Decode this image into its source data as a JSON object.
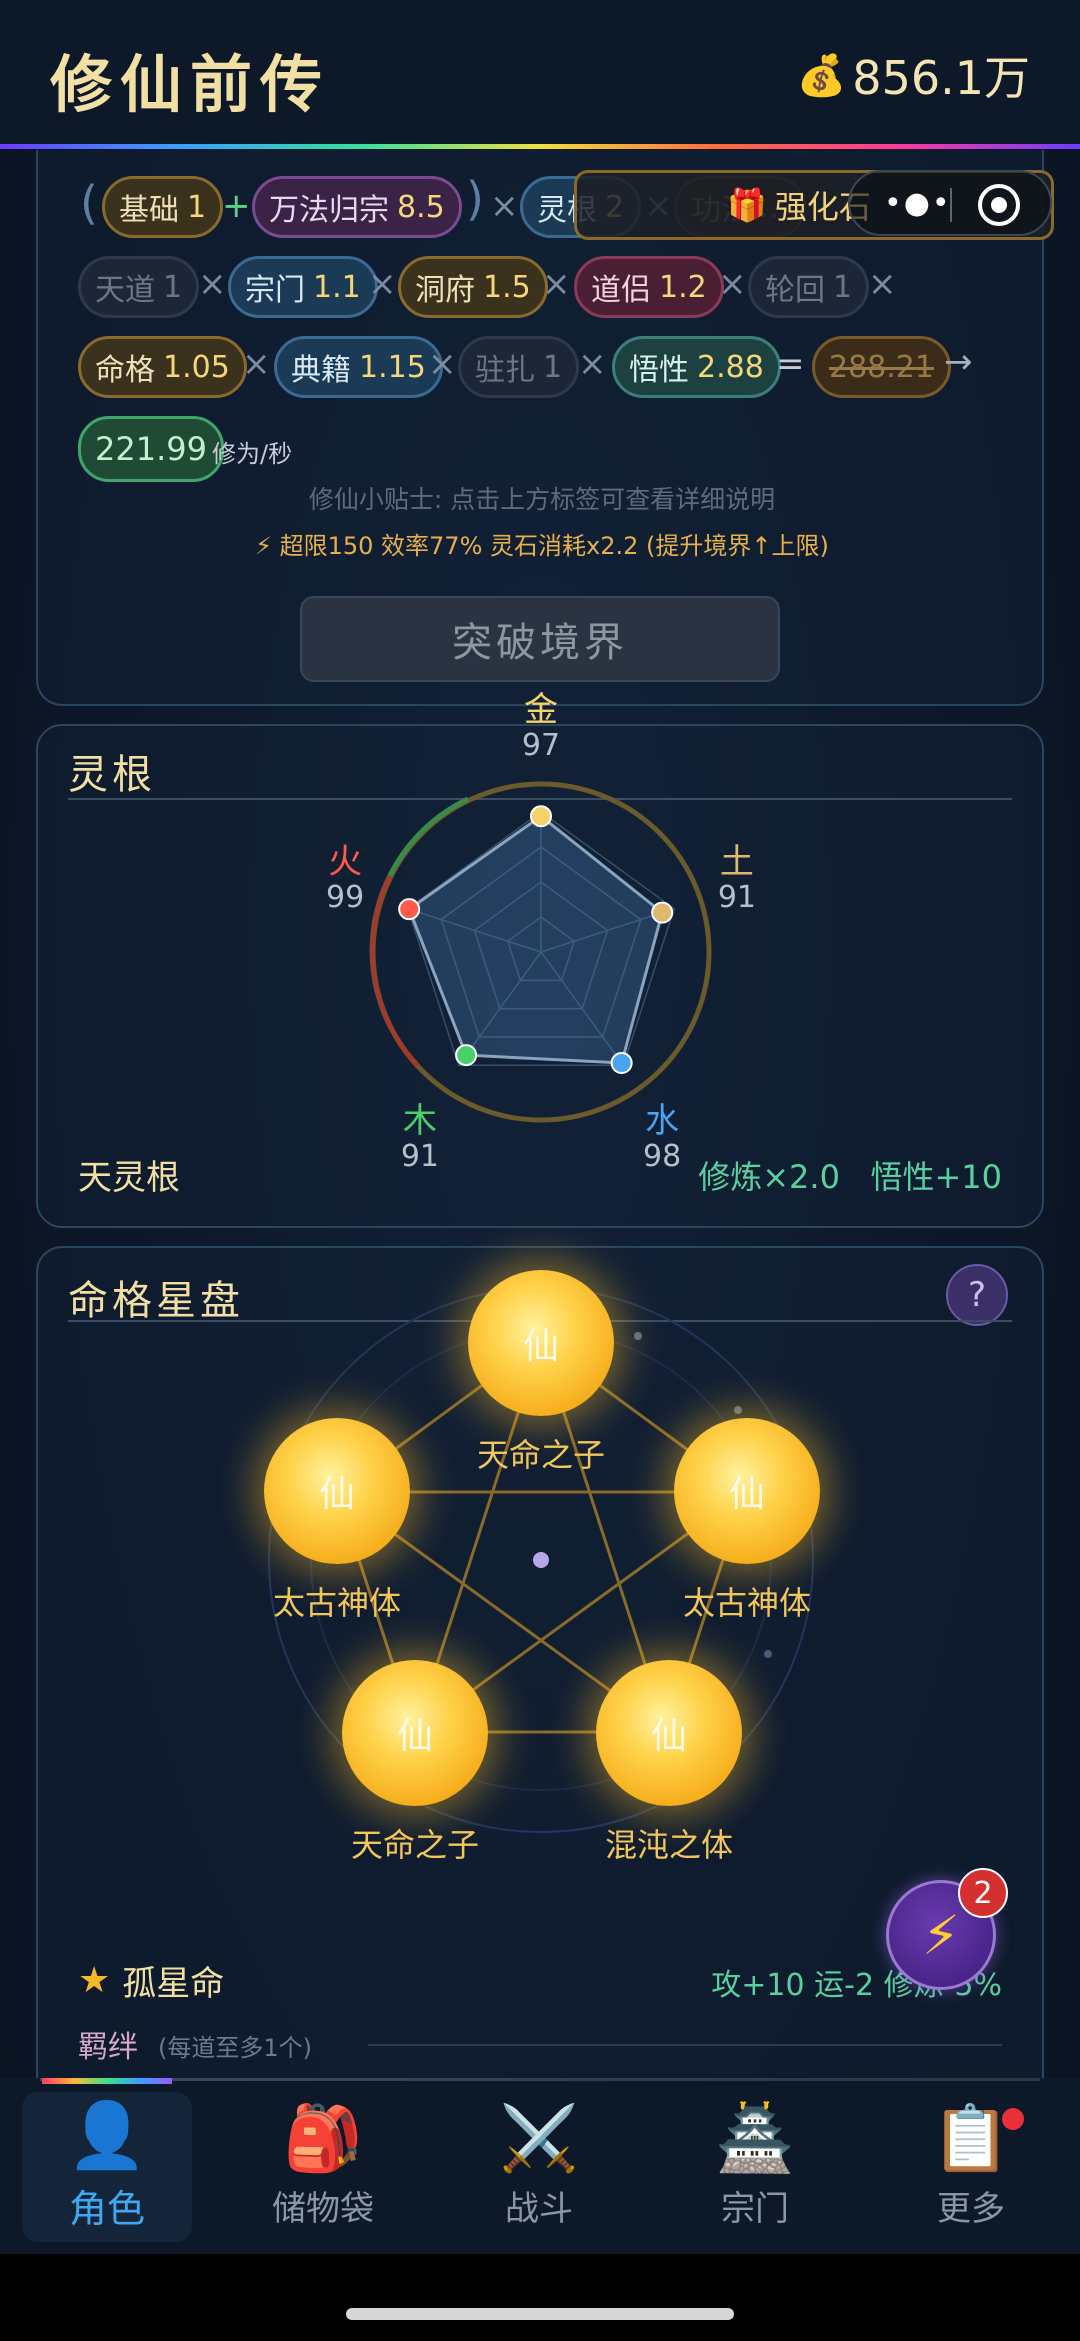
{
  "header": {
    "title": "修仙前传",
    "money_icon": "money-bag-icon",
    "money": "856.1万"
  },
  "formula": {
    "row1": [
      {
        "label": "基础",
        "value": "1"
      },
      {
        "label": "万法归宗",
        "value": "8.5"
      },
      {
        "label": "灵根",
        "value": "2"
      },
      {
        "label": "功法",
        "value": "…"
      }
    ],
    "row2": [
      {
        "label": "天道",
        "value": "1"
      },
      {
        "label": "宗门",
        "value": "1.1"
      },
      {
        "label": "洞府",
        "value": "1.5"
      },
      {
        "label": "道侣",
        "value": "1.2"
      },
      {
        "label": "轮回",
        "value": "1"
      }
    ],
    "row3": [
      {
        "label": "命格",
        "value": "1.05"
      },
      {
        "label": "典籍",
        "value": "1.15"
      },
      {
        "label": "驻扎",
        "value": "1"
      },
      {
        "label": "悟性",
        "value": "2.88"
      }
    ],
    "original": "288.21",
    "result": "221.99",
    "unit": "修为/秒",
    "tip": "修仙小贴士: 点击上方标签可查看详细说明",
    "limit": "⚡ 超限150 效率77% 灵石消耗x2.2 (提升境界↑上限)",
    "breakthrough": "突破境界"
  },
  "overlay": {
    "enhance_label": "强化石"
  },
  "spirit_root": {
    "title": "灵根",
    "elements": [
      {
        "name": "金",
        "value": "97",
        "color": "#f5d26a"
      },
      {
        "name": "土",
        "value": "91",
        "color": "#e0b86a"
      },
      {
        "name": "水",
        "value": "98",
        "color": "#4aa3f0"
      },
      {
        "name": "木",
        "value": "91",
        "color": "#4ad06a"
      },
      {
        "name": "火",
        "value": "99",
        "color": "#ff5a4a"
      }
    ],
    "type": "天灵根",
    "bonus": "修炼×2.0   悟性+10"
  },
  "destiny": {
    "title": "命格星盘",
    "help": "?",
    "orb_char": "仙",
    "orbs": [
      "天命之子",
      "太古神体",
      "太古神体",
      "天命之子",
      "混沌之体"
    ],
    "fate": "孤星命",
    "fate_bonus": "攻+10 运-2 修炼-5%",
    "bond": "羁绊",
    "bond_note": "(每道至多1个)"
  },
  "fab": {
    "badge": "2"
  },
  "nav": [
    {
      "label": "角色",
      "icon": "character-icon"
    },
    {
      "label": "储物袋",
      "icon": "backpack-icon"
    },
    {
      "label": "战斗",
      "icon": "swords-icon"
    },
    {
      "label": "宗门",
      "icon": "pagoda-icon"
    },
    {
      "label": "更多",
      "icon": "clipboard-icon"
    }
  ]
}
